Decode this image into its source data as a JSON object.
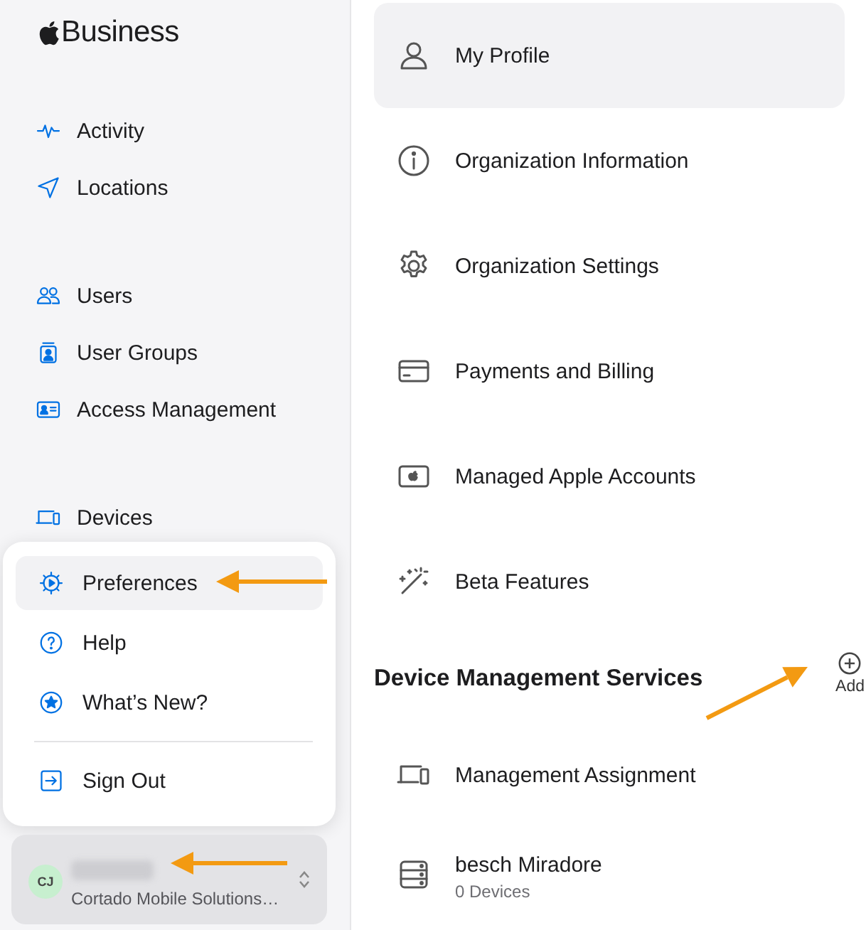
{
  "brand": {
    "name": "Business"
  },
  "sidebar": {
    "sections": [
      [
        {
          "label": "Activity"
        },
        {
          "label": "Locations"
        }
      ],
      [
        {
          "label": "Users"
        },
        {
          "label": "User Groups"
        },
        {
          "label": "Access Management"
        }
      ],
      [
        {
          "label": "Devices"
        }
      ]
    ]
  },
  "menu": {
    "groups": [
      [
        {
          "label": "Preferences",
          "selected": true
        },
        {
          "label": "Help",
          "selected": false
        },
        {
          "label": "What’s New?",
          "selected": false
        }
      ],
      [
        {
          "label": "Sign Out",
          "selected": false
        }
      ]
    ]
  },
  "account": {
    "initials": "CJ",
    "organization": "Cortado Mobile Solutions…"
  },
  "settings": {
    "items": [
      {
        "label": "My Profile",
        "selected": true
      },
      {
        "label": "Organization Information",
        "selected": false
      },
      {
        "label": "Organization Settings",
        "selected": false
      },
      {
        "label": "Payments and Billing",
        "selected": false
      },
      {
        "label": "Managed Apple Accounts",
        "selected": false
      },
      {
        "label": "Beta Features",
        "selected": false
      }
    ]
  },
  "device_management": {
    "title": "Device Management Services",
    "add_label": "Add",
    "items": [
      {
        "label": "Management Assignment"
      },
      {
        "label": "besch Miradore",
        "subtitle": "0 Devices"
      }
    ]
  }
}
